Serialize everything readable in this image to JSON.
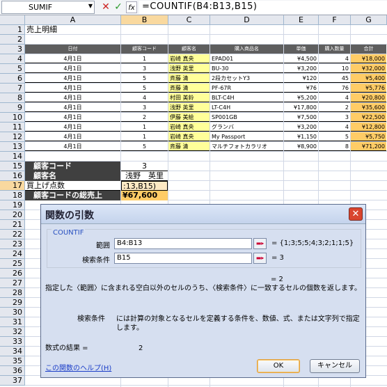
{
  "formula_bar": {
    "name_box": "SUMIF",
    "cancel_glyph": "✕",
    "enter_glyph": "✓",
    "fx_label": "fx",
    "formula": "=COUNTIF(B4:B13,B15)"
  },
  "columns": [
    "A",
    "B",
    "C",
    "D",
    "E",
    "F",
    "G"
  ],
  "rows": [
    "1",
    "2",
    "3",
    "4",
    "5",
    "6",
    "7",
    "8",
    "9",
    "10",
    "11",
    "12",
    "13",
    "14",
    "15",
    "16",
    "17",
    "18",
    "19",
    "20",
    "21",
    "22",
    "23",
    "24",
    "25",
    "26",
    "27",
    "28",
    "29",
    "30",
    "31",
    "32",
    "33",
    "34",
    "35",
    "36",
    "37"
  ],
  "selected_row": "17",
  "selected_col": "B",
  "sheet": {
    "title": "売上明細",
    "headers": [
      "日付",
      "顧客コード",
      "顧客名",
      "購入商品名",
      "単価",
      "購入数量",
      "合計"
    ],
    "data_rows": [
      [
        "4月1日",
        "1",
        "岩崎 真央",
        "EPAD01",
        "¥4,500",
        "4",
        "¥18,000"
      ],
      [
        "4月1日",
        "3",
        "浅野 英里",
        "BU-30",
        "¥3,200",
        "10",
        "¥32,000"
      ],
      [
        "4月1日",
        "5",
        "斉藤 清",
        "2段カセットY3",
        "¥120",
        "45",
        "¥5,400"
      ],
      [
        "4月1日",
        "5",
        "斉藤 清",
        "PF-67R",
        "¥76",
        "76",
        "¥5,776"
      ],
      [
        "4月1日",
        "4",
        "村田 美鈴",
        "BLT-C4H",
        "¥5,200",
        "4",
        "¥20,800"
      ],
      [
        "4月1日",
        "3",
        "浅野 英里",
        "LT-C4H",
        "¥17,800",
        "2",
        "¥35,600"
      ],
      [
        "4月1日",
        "2",
        "伊藤 美絵",
        "SP001GB",
        "¥7,500",
        "3",
        "¥22,500"
      ],
      [
        "4月1日",
        "1",
        "岩崎 真央",
        "グランバ",
        "¥3,200",
        "4",
        "¥12,800"
      ],
      [
        "4月1日",
        "1",
        "岩崎 真央",
        "My Passport",
        "¥1,150",
        "5",
        "¥5,750"
      ],
      [
        "4月1日",
        "5",
        "斉藤 清",
        "マルチフォトカラリオ",
        "¥8,900",
        "8",
        "¥71,200"
      ]
    ],
    "summary": {
      "code_label": "顧客コード",
      "code_value": "3",
      "name_label": "顧客名",
      "name_value": "浅野　英里",
      "count_label": "買上げ点数",
      "count_editing": ":13,B15)",
      "total_label": "顧客コードの総売上",
      "total_value": "¥67,600"
    }
  },
  "dialog": {
    "title": "関数の引数",
    "close_glyph": "✕",
    "function_name": "COUNTIF",
    "arg1_label": "範囲",
    "arg1_value": "B4:B13",
    "arg1_result": "= {1;3;5;5;4;3;2;1;1;5}",
    "arg2_label": "検索条件",
    "arg2_value": "B15",
    "arg2_result": "= 3",
    "formula_result_inline": "= 2",
    "description": "指定した〈範囲〉に含まれる空白以外のセルのうち、〈検索条件〉に一致するセルの個数を返します。",
    "criteria_label": "検索条件",
    "criteria_desc": "には計算の対象となるセルを定義する条件を、数値、式、または文字列で指定します。",
    "result_label": "数式の結果 =",
    "result_value": "2",
    "help_link": "この関数のヘルプ(H)",
    "ok_label": "OK",
    "cancel_label": "キャンセル"
  }
}
